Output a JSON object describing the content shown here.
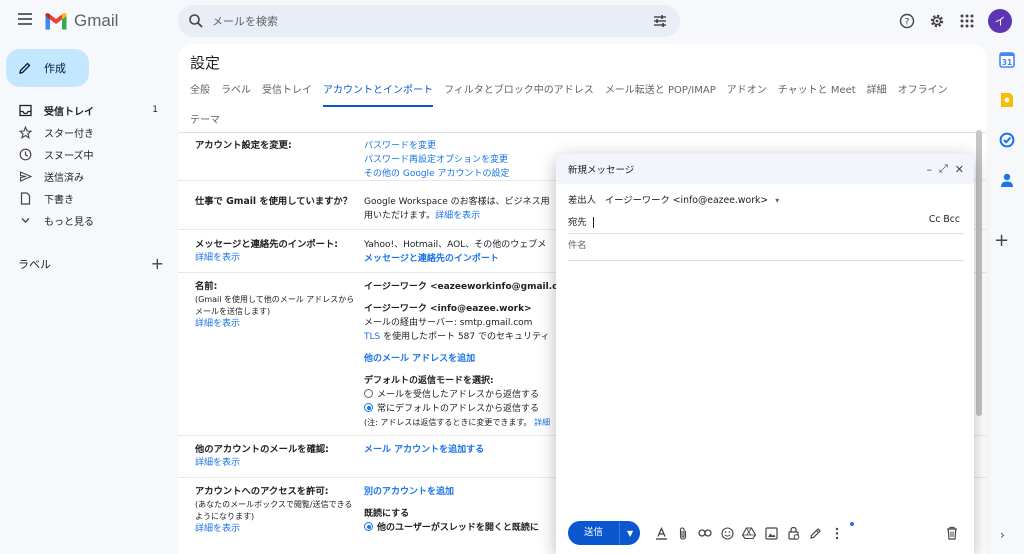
{
  "app": {
    "name": "Gmail"
  },
  "search": {
    "placeholder": "メールを検索"
  },
  "user": {
    "avatar_letter": "イ"
  },
  "sidebar": {
    "compose_label": "作成",
    "items": [
      {
        "label": "受信トレイ",
        "count": "1"
      },
      {
        "label": "スター付き"
      },
      {
        "label": "スヌーズ中"
      },
      {
        "label": "送信済み"
      },
      {
        "label": "下書き"
      },
      {
        "label": "もっと見る"
      }
    ],
    "labels_title": "ラベル",
    "labels_add": "+"
  },
  "settings": {
    "title": "設定",
    "tabs_row1": [
      "全般",
      "ラベル",
      "受信トレイ",
      "アカウントとインポート",
      "フィルタとブロック中のアドレス",
      "メール転送と POP/IMAP",
      "アドオン",
      "チャットと Meet",
      "詳細",
      "オフライン"
    ],
    "tabs_row2": [
      "テーマ"
    ],
    "rows": {
      "account": {
        "label": "アカウント設定を変更:",
        "links": [
          "パスワードを変更",
          "パスワード再設定オプションを変更",
          "その他の Google アカウントの設定"
        ]
      },
      "workspace": {
        "label": "仕事で Gmail を使用していますか？",
        "line1": "Google Workspace のお客様は、ビジネス用",
        "line2": "用いただけます。",
        "link": "詳細を表示"
      },
      "import": {
        "label": "メッセージと連絡先のインポート:",
        "sublink": "詳細を表示",
        "line1": "Yahoo!、Hotmail、AOL、その他のウェブメ",
        "link": "メッセージと連絡先のインポート"
      },
      "name": {
        "label": "名前:",
        "sub1": "(Gmail を使用して他のメール アドレスから",
        "sub2": "メールを送信します)",
        "sublink": "詳細を表示",
        "addr1": "イージーワーク <eazeeworkinfo@gmail.co",
        "addr2": "イージーワーク <info@eazee.work>",
        "server": "メールの経由サーバー: smtp.gmail.com",
        "tls_link": "TLS",
        "tls_text": " を使用したポート 587 でのセキュリティ",
        "add_link": "他のメール アドレスを追加",
        "reply_title": "デフォルトの返信モードを選択:",
        "reply_opt1": "メールを受信したアドレスから返信する",
        "reply_opt2": "常にデフォルトのアドレスから返信する",
        "note": "(注: アドレスは返信するときに変更できます。",
        "note_link": "詳細"
      },
      "check": {
        "label": "他のアカウントのメールを確認:",
        "sublink": "詳細を表示",
        "link": "メール アカウントを追加する"
      },
      "grant": {
        "label": "アカウントへのアクセスを許可:",
        "sub1": "(あなたのメールボックスで閲覧/送信できる",
        "sub2": "ようになります)",
        "sublink": "詳細を表示",
        "link": "別のアカウントを追加",
        "read_title": "既読にする",
        "read_opt1": "他のユーザーがスレッドを開くと既読に"
      }
    }
  },
  "compose": {
    "title": "新規メッセージ",
    "from_label": "差出人",
    "from_value": "イージーワーク <info@eazee.work>",
    "to_label": "宛先",
    "cc_bcc": "Cc Bcc",
    "subject_placeholder": "件名",
    "send_label": "送信"
  }
}
